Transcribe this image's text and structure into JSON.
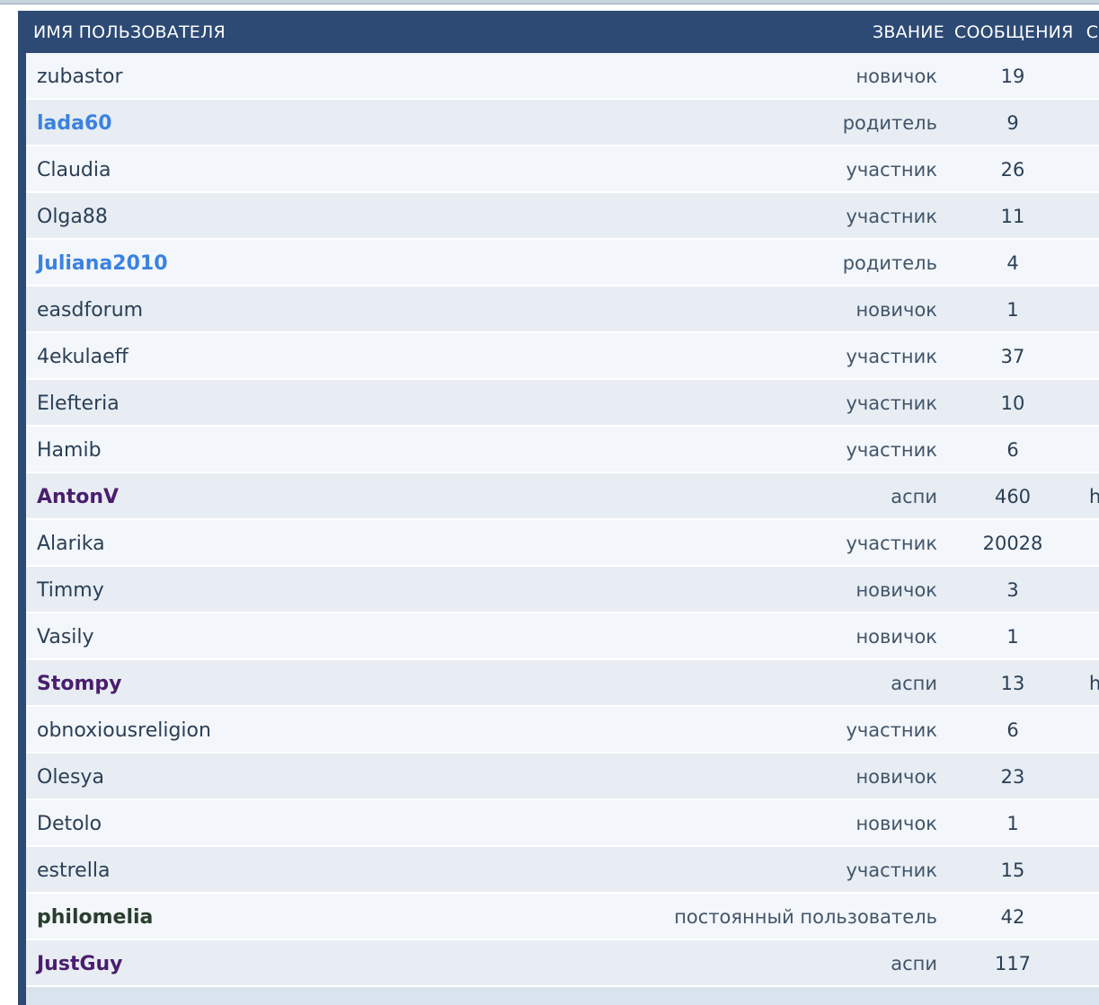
{
  "header": {
    "username": "ИМЯ ПОЛЬЗОВАТЕЛЯ",
    "rank": "ЗВАНИЕ",
    "posts": "СООБЩЕНИЯ",
    "extra": "С"
  },
  "users": [
    {
      "name": "zubastor",
      "rank": "новичок",
      "posts": "19",
      "extra": "",
      "style": "normal"
    },
    {
      "name": "lada60",
      "rank": "родитель",
      "posts": "9",
      "extra": "",
      "style": "parent"
    },
    {
      "name": "Claudia",
      "rank": "участник",
      "posts": "26",
      "extra": "",
      "style": "normal"
    },
    {
      "name": "Olga88",
      "rank": "участник",
      "posts": "11",
      "extra": "",
      "style": "normal"
    },
    {
      "name": "Juliana2010",
      "rank": "родитель",
      "posts": "4",
      "extra": "",
      "style": "parent"
    },
    {
      "name": "easdforum",
      "rank": "новичок",
      "posts": "1",
      "extra": "",
      "style": "normal"
    },
    {
      "name": "4ekulaeff",
      "rank": "участник",
      "posts": "37",
      "extra": "",
      "style": "normal"
    },
    {
      "name": "Elefteria",
      "rank": "участник",
      "posts": "10",
      "extra": "",
      "style": "normal"
    },
    {
      "name": "Hamib",
      "rank": "участник",
      "posts": "6",
      "extra": "",
      "style": "normal"
    },
    {
      "name": "AntonV",
      "rank": "аспи",
      "posts": "460",
      "extra": "h",
      "style": "aspi"
    },
    {
      "name": "Alarika",
      "rank": "участник",
      "posts": "20028",
      "extra": "",
      "style": "normal"
    },
    {
      "name": "Timmy",
      "rank": "новичок",
      "posts": "3",
      "extra": "",
      "style": "normal"
    },
    {
      "name": "Vasily",
      "rank": "новичок",
      "posts": "1",
      "extra": "",
      "style": "normal"
    },
    {
      "name": "Stompy",
      "rank": "аспи",
      "posts": "13",
      "extra": "h",
      "style": "aspi"
    },
    {
      "name": "obnoxiousreligion",
      "rank": "участник",
      "posts": "6",
      "extra": "",
      "style": "normal"
    },
    {
      "name": "Olesya",
      "rank": "новичок",
      "posts": "23",
      "extra": "",
      "style": "normal"
    },
    {
      "name": "Detolo",
      "rank": "новичок",
      "posts": "1",
      "extra": "",
      "style": "normal"
    },
    {
      "name": "estrella",
      "rank": "участник",
      "posts": "15",
      "extra": "",
      "style": "normal"
    },
    {
      "name": "philomelia",
      "rank": "постоянный пользователь",
      "posts": "42",
      "extra": "",
      "style": "regular"
    },
    {
      "name": "JustGuy",
      "rank": "аспи",
      "posts": "117",
      "extra": "",
      "style": "aspi"
    }
  ],
  "colors": {
    "header_bg": "#2c4a74",
    "row_odd": "#f3f6fa",
    "row_even": "#e7edf3",
    "parent_name": "#3b82e0",
    "aspi_name": "#4a1d6e",
    "regular_name": "#2a3d2f",
    "normal_name": "#2a3f56"
  }
}
